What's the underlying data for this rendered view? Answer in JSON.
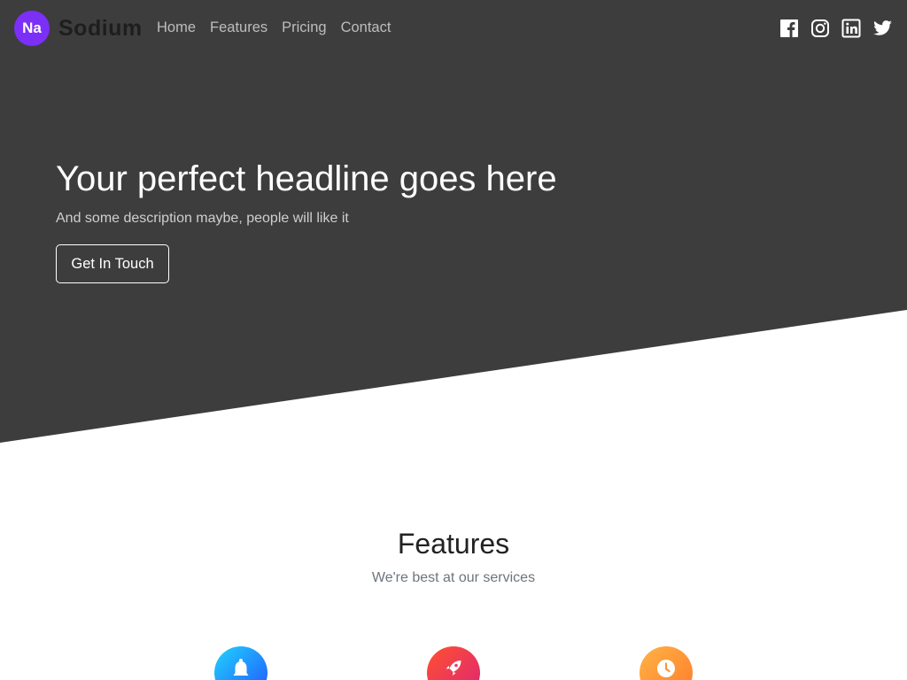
{
  "brand": {
    "badge": "Na",
    "name": "Sodium"
  },
  "nav": {
    "links": [
      "Home",
      "Features",
      "Pricing",
      "Contact"
    ]
  },
  "social": [
    "facebook-icon",
    "instagram-icon",
    "linkedin-icon",
    "twitter-icon"
  ],
  "hero": {
    "title": "Your perfect headline goes here",
    "description": "And some description maybe, people will like it",
    "cta_label": "Get In Touch"
  },
  "features": {
    "title": "Features",
    "subtitle": "We're best at our services",
    "icons": [
      "bell-icon",
      "rocket-icon",
      "clock-icon"
    ]
  },
  "colors": {
    "hero_bg": "#3d3d3d",
    "brand_badge": "#7b2ff7",
    "page_bg": "#ffffff"
  }
}
